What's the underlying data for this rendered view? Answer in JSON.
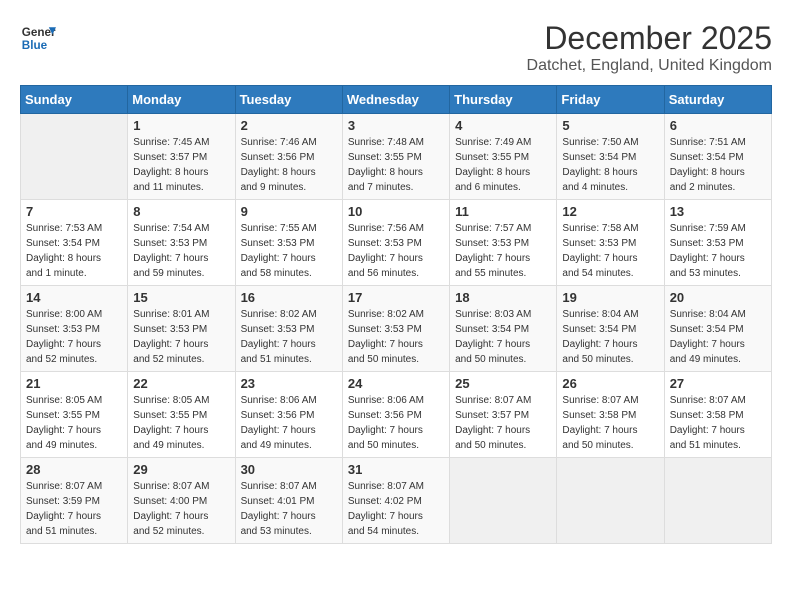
{
  "logo": {
    "line1": "General",
    "line2": "Blue"
  },
  "title": "December 2025",
  "subtitle": "Datchet, England, United Kingdom",
  "days_of_week": [
    "Sunday",
    "Monday",
    "Tuesday",
    "Wednesday",
    "Thursday",
    "Friday",
    "Saturday"
  ],
  "weeks": [
    [
      {
        "day": "",
        "info": ""
      },
      {
        "day": "1",
        "info": "Sunrise: 7:45 AM\nSunset: 3:57 PM\nDaylight: 8 hours\nand 11 minutes."
      },
      {
        "day": "2",
        "info": "Sunrise: 7:46 AM\nSunset: 3:56 PM\nDaylight: 8 hours\nand 9 minutes."
      },
      {
        "day": "3",
        "info": "Sunrise: 7:48 AM\nSunset: 3:55 PM\nDaylight: 8 hours\nand 7 minutes."
      },
      {
        "day": "4",
        "info": "Sunrise: 7:49 AM\nSunset: 3:55 PM\nDaylight: 8 hours\nand 6 minutes."
      },
      {
        "day": "5",
        "info": "Sunrise: 7:50 AM\nSunset: 3:54 PM\nDaylight: 8 hours\nand 4 minutes."
      },
      {
        "day": "6",
        "info": "Sunrise: 7:51 AM\nSunset: 3:54 PM\nDaylight: 8 hours\nand 2 minutes."
      }
    ],
    [
      {
        "day": "7",
        "info": "Sunrise: 7:53 AM\nSunset: 3:54 PM\nDaylight: 8 hours\nand 1 minute."
      },
      {
        "day": "8",
        "info": "Sunrise: 7:54 AM\nSunset: 3:53 PM\nDaylight: 7 hours\nand 59 minutes."
      },
      {
        "day": "9",
        "info": "Sunrise: 7:55 AM\nSunset: 3:53 PM\nDaylight: 7 hours\nand 58 minutes."
      },
      {
        "day": "10",
        "info": "Sunrise: 7:56 AM\nSunset: 3:53 PM\nDaylight: 7 hours\nand 56 minutes."
      },
      {
        "day": "11",
        "info": "Sunrise: 7:57 AM\nSunset: 3:53 PM\nDaylight: 7 hours\nand 55 minutes."
      },
      {
        "day": "12",
        "info": "Sunrise: 7:58 AM\nSunset: 3:53 PM\nDaylight: 7 hours\nand 54 minutes."
      },
      {
        "day": "13",
        "info": "Sunrise: 7:59 AM\nSunset: 3:53 PM\nDaylight: 7 hours\nand 53 minutes."
      }
    ],
    [
      {
        "day": "14",
        "info": "Sunrise: 8:00 AM\nSunset: 3:53 PM\nDaylight: 7 hours\nand 52 minutes."
      },
      {
        "day": "15",
        "info": "Sunrise: 8:01 AM\nSunset: 3:53 PM\nDaylight: 7 hours\nand 52 minutes."
      },
      {
        "day": "16",
        "info": "Sunrise: 8:02 AM\nSunset: 3:53 PM\nDaylight: 7 hours\nand 51 minutes."
      },
      {
        "day": "17",
        "info": "Sunrise: 8:02 AM\nSunset: 3:53 PM\nDaylight: 7 hours\nand 50 minutes."
      },
      {
        "day": "18",
        "info": "Sunrise: 8:03 AM\nSunset: 3:54 PM\nDaylight: 7 hours\nand 50 minutes."
      },
      {
        "day": "19",
        "info": "Sunrise: 8:04 AM\nSunset: 3:54 PM\nDaylight: 7 hours\nand 50 minutes."
      },
      {
        "day": "20",
        "info": "Sunrise: 8:04 AM\nSunset: 3:54 PM\nDaylight: 7 hours\nand 49 minutes."
      }
    ],
    [
      {
        "day": "21",
        "info": "Sunrise: 8:05 AM\nSunset: 3:55 PM\nDaylight: 7 hours\nand 49 minutes."
      },
      {
        "day": "22",
        "info": "Sunrise: 8:05 AM\nSunset: 3:55 PM\nDaylight: 7 hours\nand 49 minutes."
      },
      {
        "day": "23",
        "info": "Sunrise: 8:06 AM\nSunset: 3:56 PM\nDaylight: 7 hours\nand 49 minutes."
      },
      {
        "day": "24",
        "info": "Sunrise: 8:06 AM\nSunset: 3:56 PM\nDaylight: 7 hours\nand 50 minutes."
      },
      {
        "day": "25",
        "info": "Sunrise: 8:07 AM\nSunset: 3:57 PM\nDaylight: 7 hours\nand 50 minutes."
      },
      {
        "day": "26",
        "info": "Sunrise: 8:07 AM\nSunset: 3:58 PM\nDaylight: 7 hours\nand 50 minutes."
      },
      {
        "day": "27",
        "info": "Sunrise: 8:07 AM\nSunset: 3:58 PM\nDaylight: 7 hours\nand 51 minutes."
      }
    ],
    [
      {
        "day": "28",
        "info": "Sunrise: 8:07 AM\nSunset: 3:59 PM\nDaylight: 7 hours\nand 51 minutes."
      },
      {
        "day": "29",
        "info": "Sunrise: 8:07 AM\nSunset: 4:00 PM\nDaylight: 7 hours\nand 52 minutes."
      },
      {
        "day": "30",
        "info": "Sunrise: 8:07 AM\nSunset: 4:01 PM\nDaylight: 7 hours\nand 53 minutes."
      },
      {
        "day": "31",
        "info": "Sunrise: 8:07 AM\nSunset: 4:02 PM\nDaylight: 7 hours\nand 54 minutes."
      },
      {
        "day": "",
        "info": ""
      },
      {
        "day": "",
        "info": ""
      },
      {
        "day": "",
        "info": ""
      }
    ]
  ]
}
